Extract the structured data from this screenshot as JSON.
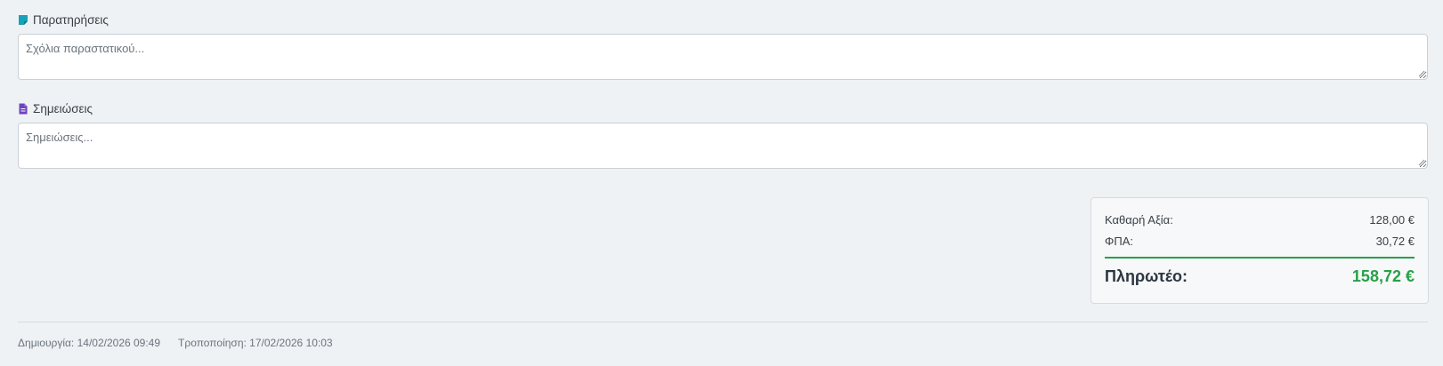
{
  "remarks": {
    "label": "Παρατηρήσεις",
    "icon": "sticky-note-icon",
    "icon_color": "#17a2b8",
    "placeholder": "Σχόλια παραστατικού...",
    "value": ""
  },
  "notes": {
    "label": "Σημειώσεις",
    "icon": "file-text-icon",
    "icon_color": "#6f42c1",
    "placeholder": "Σημειώσεις...",
    "value": ""
  },
  "totals": {
    "net_label": "Καθαρή Αξία:",
    "net_value": "128,00 €",
    "vat_label": "ΦΠΑ:",
    "vat_value": "30,72 €",
    "payable_label": "Πληρωτέο:",
    "payable_value": "158,72 €",
    "accent_color": "#27a147"
  },
  "footer": {
    "created": "Δημιουργία: 14/02/2026 09:49",
    "modified": "Τροποποίηση: 17/02/2026 10:03"
  }
}
